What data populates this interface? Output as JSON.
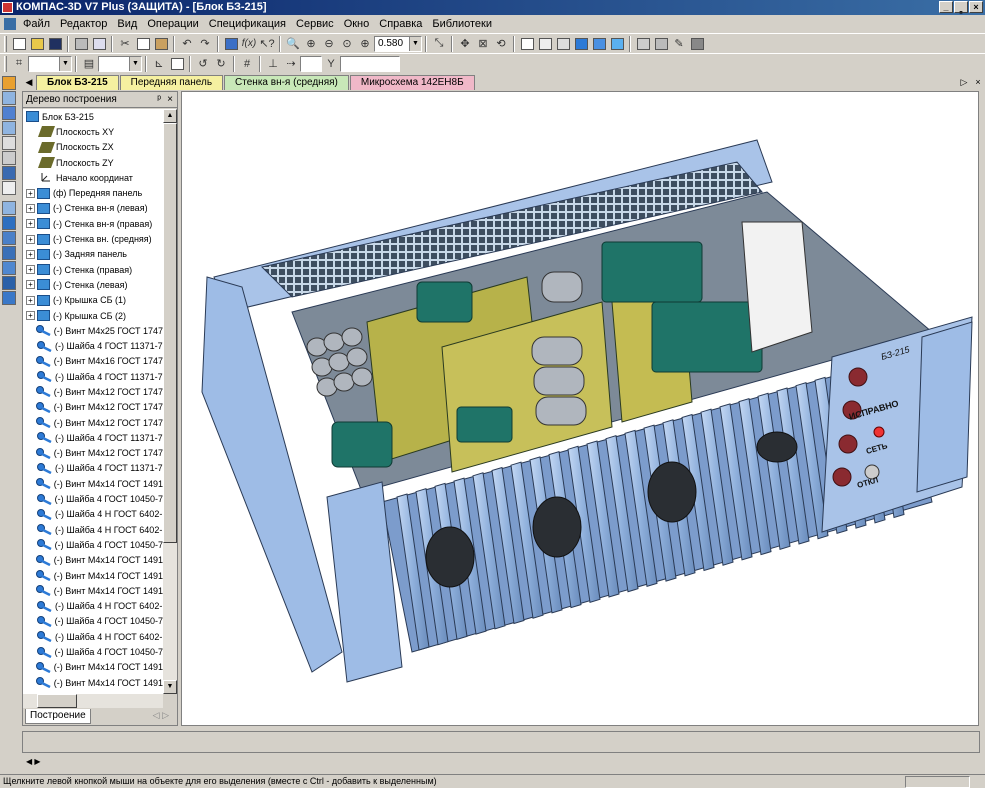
{
  "window": {
    "title": "КОМПАС-3D V7 Plus (ЗАЩИТА) - [Блок БЗ-215]",
    "controls": [
      "_",
      "̳",
      "×"
    ]
  },
  "menu": [
    "Файл",
    "Редактор",
    "Вид",
    "Операции",
    "Спецификация",
    "Сервис",
    "Окно",
    "Справка",
    "Библиотеки"
  ],
  "toolbar": {
    "zoom_value": "0.580"
  },
  "doc_tabs": [
    {
      "label": "Блок БЗ-215",
      "active": true,
      "color": "#f5f0a0"
    },
    {
      "label": "Передняя панель",
      "active": false,
      "color": "#f5f0a0"
    },
    {
      "label": "Стенка вн-я (средняя)",
      "active": false,
      "color": "#c8e8b8"
    },
    {
      "label": "Микросхема 142ЕН8Б",
      "active": false,
      "color": "#f0b8c8"
    }
  ],
  "tree": {
    "title": "Дерево построения",
    "bottom_tab": "Построение",
    "items": [
      {
        "label": "Блок БЗ-215",
        "icon": "assembly-icon",
        "indent": 0,
        "expander": ""
      },
      {
        "label": "Плоскость XY",
        "icon": "plane-icon",
        "indent": 1,
        "expander": ""
      },
      {
        "label": "Плоскость ZX",
        "icon": "plane-icon",
        "indent": 1,
        "expander": ""
      },
      {
        "label": "Плоскость ZY",
        "icon": "plane-icon",
        "indent": 1,
        "expander": ""
      },
      {
        "label": "Начало координат",
        "icon": "origin-icon",
        "indent": 1,
        "expander": ""
      },
      {
        "label": "(ф) Передняя панель",
        "icon": "part-icon",
        "indent": 0,
        "expander": "+"
      },
      {
        "label": "(-) Стенка вн-я (левая)",
        "icon": "part-icon",
        "indent": 0,
        "expander": "+"
      },
      {
        "label": "(-) Стенка вн-я (правая)",
        "icon": "part-icon",
        "indent": 0,
        "expander": "+"
      },
      {
        "label": "(-) Стенка вн. (средняя)",
        "icon": "part-icon",
        "indent": 0,
        "expander": "+"
      },
      {
        "label": "(-) Задняя панель",
        "icon": "part-icon",
        "indent": 0,
        "expander": "+"
      },
      {
        "label": "(-) Стенка (правая)",
        "icon": "part-icon",
        "indent": 0,
        "expander": "+"
      },
      {
        "label": "(-) Стенка (левая)",
        "icon": "part-icon",
        "indent": 0,
        "expander": "+"
      },
      {
        "label": "(-) Крышка СБ (1)",
        "icon": "part-icon",
        "indent": 0,
        "expander": "+"
      },
      {
        "label": "(-) Крышка СБ (2)",
        "icon": "part-icon",
        "indent": 0,
        "expander": "+"
      },
      {
        "label": "(-) Винт М4х25 ГОСТ 1747",
        "icon": "fastener-icon",
        "indent": 0,
        "expander": ""
      },
      {
        "label": "(-) Шайба 4 ГОСТ 11371-7",
        "icon": "fastener-icon",
        "indent": 0,
        "expander": ""
      },
      {
        "label": "(-) Винт М4х16 ГОСТ 1747",
        "icon": "fastener-icon",
        "indent": 0,
        "expander": ""
      },
      {
        "label": "(-) Шайба 4 ГОСТ 11371-7",
        "icon": "fastener-icon",
        "indent": 0,
        "expander": ""
      },
      {
        "label": "(-) Винт М4х12 ГОСТ 1747",
        "icon": "fastener-icon",
        "indent": 0,
        "expander": ""
      },
      {
        "label": "(-) Винт М4х12 ГОСТ 1747",
        "icon": "fastener-icon",
        "indent": 0,
        "expander": ""
      },
      {
        "label": "(-) Винт М4х12 ГОСТ 1747",
        "icon": "fastener-icon",
        "indent": 0,
        "expander": ""
      },
      {
        "label": "(-) Шайба 4 ГОСТ 11371-7",
        "icon": "fastener-icon",
        "indent": 0,
        "expander": ""
      },
      {
        "label": "(-) Винт М4х12 ГОСТ 1747",
        "icon": "fastener-icon",
        "indent": 0,
        "expander": ""
      },
      {
        "label": "(-) Шайба 4 ГОСТ 11371-7",
        "icon": "fastener-icon",
        "indent": 0,
        "expander": ""
      },
      {
        "label": "(-) Винт М4х14 ГОСТ 1491",
        "icon": "fastener-icon",
        "indent": 0,
        "expander": ""
      },
      {
        "label": "(-) Шайба 4 ГОСТ 10450-7",
        "icon": "fastener-icon",
        "indent": 0,
        "expander": ""
      },
      {
        "label": "(-) Шайба 4 Н ГОСТ 6402-",
        "icon": "fastener-icon",
        "indent": 0,
        "expander": ""
      },
      {
        "label": "(-) Шайба 4 Н ГОСТ 6402-",
        "icon": "fastener-icon",
        "indent": 0,
        "expander": ""
      },
      {
        "label": "(-) Шайба 4 ГОСТ 10450-7",
        "icon": "fastener-icon",
        "indent": 0,
        "expander": ""
      },
      {
        "label": "(-) Винт М4х14 ГОСТ 1491",
        "icon": "fastener-icon",
        "indent": 0,
        "expander": ""
      },
      {
        "label": "(-) Винт М4х14 ГОСТ 1491",
        "icon": "fastener-icon",
        "indent": 0,
        "expander": ""
      },
      {
        "label": "(-) Винт М4х14 ГОСТ 1491",
        "icon": "fastener-icon",
        "indent": 0,
        "expander": ""
      },
      {
        "label": "(-) Шайба 4 Н ГОСТ 6402-",
        "icon": "fastener-icon",
        "indent": 0,
        "expander": ""
      },
      {
        "label": "(-) Шайба 4 ГОСТ 10450-7",
        "icon": "fastener-icon",
        "indent": 0,
        "expander": ""
      },
      {
        "label": "(-) Шайба 4 Н ГОСТ 6402-",
        "icon": "fastener-icon",
        "indent": 0,
        "expander": ""
      },
      {
        "label": "(-) Шайба 4 ГОСТ 10450-7",
        "icon": "fastener-icon",
        "indent": 0,
        "expander": ""
      },
      {
        "label": "(-) Винт М4х14 ГОСТ 1491",
        "icon": "fastener-icon",
        "indent": 0,
        "expander": ""
      },
      {
        "label": "(-) Винт М4х14 ГОСТ 1491",
        "icon": "fastener-icon",
        "indent": 0,
        "expander": ""
      }
    ]
  },
  "model_labels": {
    "unit_name": "БЗ-215",
    "led_label": "ИСПРАВНО",
    "power_label": "СЕТЬ",
    "switch_label": "ОТКЛ"
  },
  "status": {
    "message": "Щелкните левой кнопкой мыши на объекте для его выделения (вместе с Ctrl - добавить к выделенным)"
  }
}
